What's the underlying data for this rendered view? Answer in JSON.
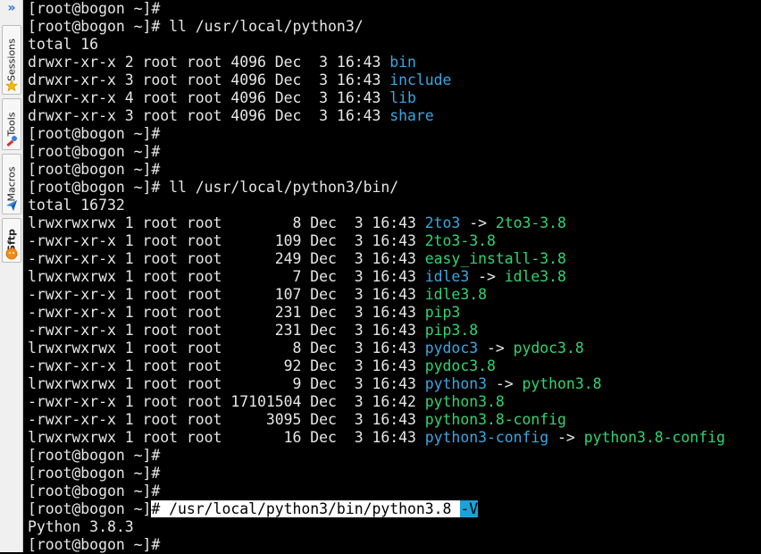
{
  "sidebar": {
    "chevron": "»",
    "tabs": [
      {
        "label": "Sessions",
        "icon": "star-icon"
      },
      {
        "label": "Tools",
        "icon": "tools-icon"
      },
      {
        "label": "Macros",
        "icon": "paper-plane-icon"
      },
      {
        "label": "Sftp",
        "icon": "sftp-icon"
      }
    ]
  },
  "colors": {
    "background": "#000000",
    "text": "#e6e6e6",
    "dir": "#3aa6e0",
    "exec": "#2fd46f",
    "select": "#ffffff",
    "cursor": "#1aa3d9"
  },
  "terminal": {
    "lines": [
      {
        "segs": [
          {
            "t": "[root@bogon ~]#",
            "c": "w"
          }
        ]
      },
      {
        "segs": [
          {
            "t": "[root@bogon ~]# ll /usr/local/python3/",
            "c": "w"
          }
        ]
      },
      {
        "segs": [
          {
            "t": "total 16",
            "c": "w"
          }
        ]
      },
      {
        "segs": [
          {
            "t": "drwxr-xr-x 2 root root 4096 Dec  3 16:43 ",
            "c": "w"
          },
          {
            "t": "bin",
            "c": "b"
          }
        ]
      },
      {
        "segs": [
          {
            "t": "drwxr-xr-x 3 root root 4096 Dec  3 16:43 ",
            "c": "w"
          },
          {
            "t": "include",
            "c": "b"
          }
        ]
      },
      {
        "segs": [
          {
            "t": "drwxr-xr-x 4 root root 4096 Dec  3 16:43 ",
            "c": "w"
          },
          {
            "t": "lib",
            "c": "b"
          }
        ]
      },
      {
        "segs": [
          {
            "t": "drwxr-xr-x 3 root root 4096 Dec  3 16:43 ",
            "c": "w"
          },
          {
            "t": "share",
            "c": "b"
          }
        ]
      },
      {
        "segs": [
          {
            "t": "[root@bogon ~]#",
            "c": "w"
          }
        ]
      },
      {
        "segs": [
          {
            "t": "[root@bogon ~]#",
            "c": "w"
          }
        ]
      },
      {
        "segs": [
          {
            "t": "[root@bogon ~]#",
            "c": "w"
          }
        ]
      },
      {
        "segs": [
          {
            "t": "[root@bogon ~]# ll /usr/local/python3/bin/",
            "c": "w"
          }
        ]
      },
      {
        "segs": [
          {
            "t": "total 16732",
            "c": "w"
          }
        ]
      },
      {
        "segs": [
          {
            "t": "lrwxrwxrwx 1 root root        8 Dec  3 16:43 ",
            "c": "w"
          },
          {
            "t": "2to3",
            "c": "b"
          },
          {
            "t": " -> ",
            "c": "w"
          },
          {
            "t": "2to3-3.8",
            "c": "g"
          }
        ]
      },
      {
        "segs": [
          {
            "t": "-rwxr-xr-x 1 root root      109 Dec  3 16:43 ",
            "c": "w"
          },
          {
            "t": "2to3-3.8",
            "c": "g"
          }
        ]
      },
      {
        "segs": [
          {
            "t": "-rwxr-xr-x 1 root root      249 Dec  3 16:43 ",
            "c": "w"
          },
          {
            "t": "easy_install-3.8",
            "c": "g"
          }
        ]
      },
      {
        "segs": [
          {
            "t": "lrwxrwxrwx 1 root root        7 Dec  3 16:43 ",
            "c": "w"
          },
          {
            "t": "idle3",
            "c": "b"
          },
          {
            "t": " -> ",
            "c": "w"
          },
          {
            "t": "idle3.8",
            "c": "g"
          }
        ]
      },
      {
        "segs": [
          {
            "t": "-rwxr-xr-x 1 root root      107 Dec  3 16:43 ",
            "c": "w"
          },
          {
            "t": "idle3.8",
            "c": "g"
          }
        ]
      },
      {
        "segs": [
          {
            "t": "-rwxr-xr-x 1 root root      231 Dec  3 16:43 ",
            "c": "w"
          },
          {
            "t": "pip3",
            "c": "g"
          }
        ]
      },
      {
        "segs": [
          {
            "t": "-rwxr-xr-x 1 root root      231 Dec  3 16:43 ",
            "c": "w"
          },
          {
            "t": "pip3.8",
            "c": "g"
          }
        ]
      },
      {
        "segs": [
          {
            "t": "lrwxrwxrwx 1 root root        8 Dec  3 16:43 ",
            "c": "w"
          },
          {
            "t": "pydoc3",
            "c": "b"
          },
          {
            "t": " -> ",
            "c": "w"
          },
          {
            "t": "pydoc3.8",
            "c": "g"
          }
        ]
      },
      {
        "segs": [
          {
            "t": "-rwxr-xr-x 1 root root       92 Dec  3 16:43 ",
            "c": "w"
          },
          {
            "t": "pydoc3.8",
            "c": "g"
          }
        ]
      },
      {
        "segs": [
          {
            "t": "lrwxrwxrwx 1 root root        9 Dec  3 16:43 ",
            "c": "w"
          },
          {
            "t": "python3",
            "c": "b"
          },
          {
            "t": " -> ",
            "c": "w"
          },
          {
            "t": "python3.8",
            "c": "g"
          }
        ]
      },
      {
        "segs": [
          {
            "t": "-rwxr-xr-x 1 root root 17101504 Dec  3 16:42 ",
            "c": "w"
          },
          {
            "t": "python3.8",
            "c": "g"
          }
        ]
      },
      {
        "segs": [
          {
            "t": "-rwxr-xr-x 1 root root     3095 Dec  3 16:43 ",
            "c": "w"
          },
          {
            "t": "python3.8-config",
            "c": "g"
          }
        ]
      },
      {
        "segs": [
          {
            "t": "lrwxrwxrwx 1 root root       16 Dec  3 16:43 ",
            "c": "w"
          },
          {
            "t": "python3-config",
            "c": "b"
          },
          {
            "t": " -> ",
            "c": "w"
          },
          {
            "t": "python3.8-config",
            "c": "g"
          }
        ]
      },
      {
        "segs": [
          {
            "t": "[root@bogon ~]#",
            "c": "w"
          }
        ]
      },
      {
        "segs": [
          {
            "t": "[root@bogon ~]#",
            "c": "w"
          }
        ]
      },
      {
        "segs": [
          {
            "t": "[root@bogon ~]#",
            "c": "w"
          }
        ]
      },
      {
        "segs": [
          {
            "t": "[root@bogon ~]",
            "c": "w"
          },
          {
            "t": "# /usr/local/python3/bin/python3.8 ",
            "c": "hl"
          },
          {
            "t": "-V",
            "c": "hlb"
          }
        ]
      },
      {
        "segs": [
          {
            "t": "Python 3.8.3",
            "c": "w"
          }
        ]
      },
      {
        "segs": [
          {
            "t": "[root@bogon ~]#",
            "c": "w"
          }
        ]
      }
    ]
  }
}
